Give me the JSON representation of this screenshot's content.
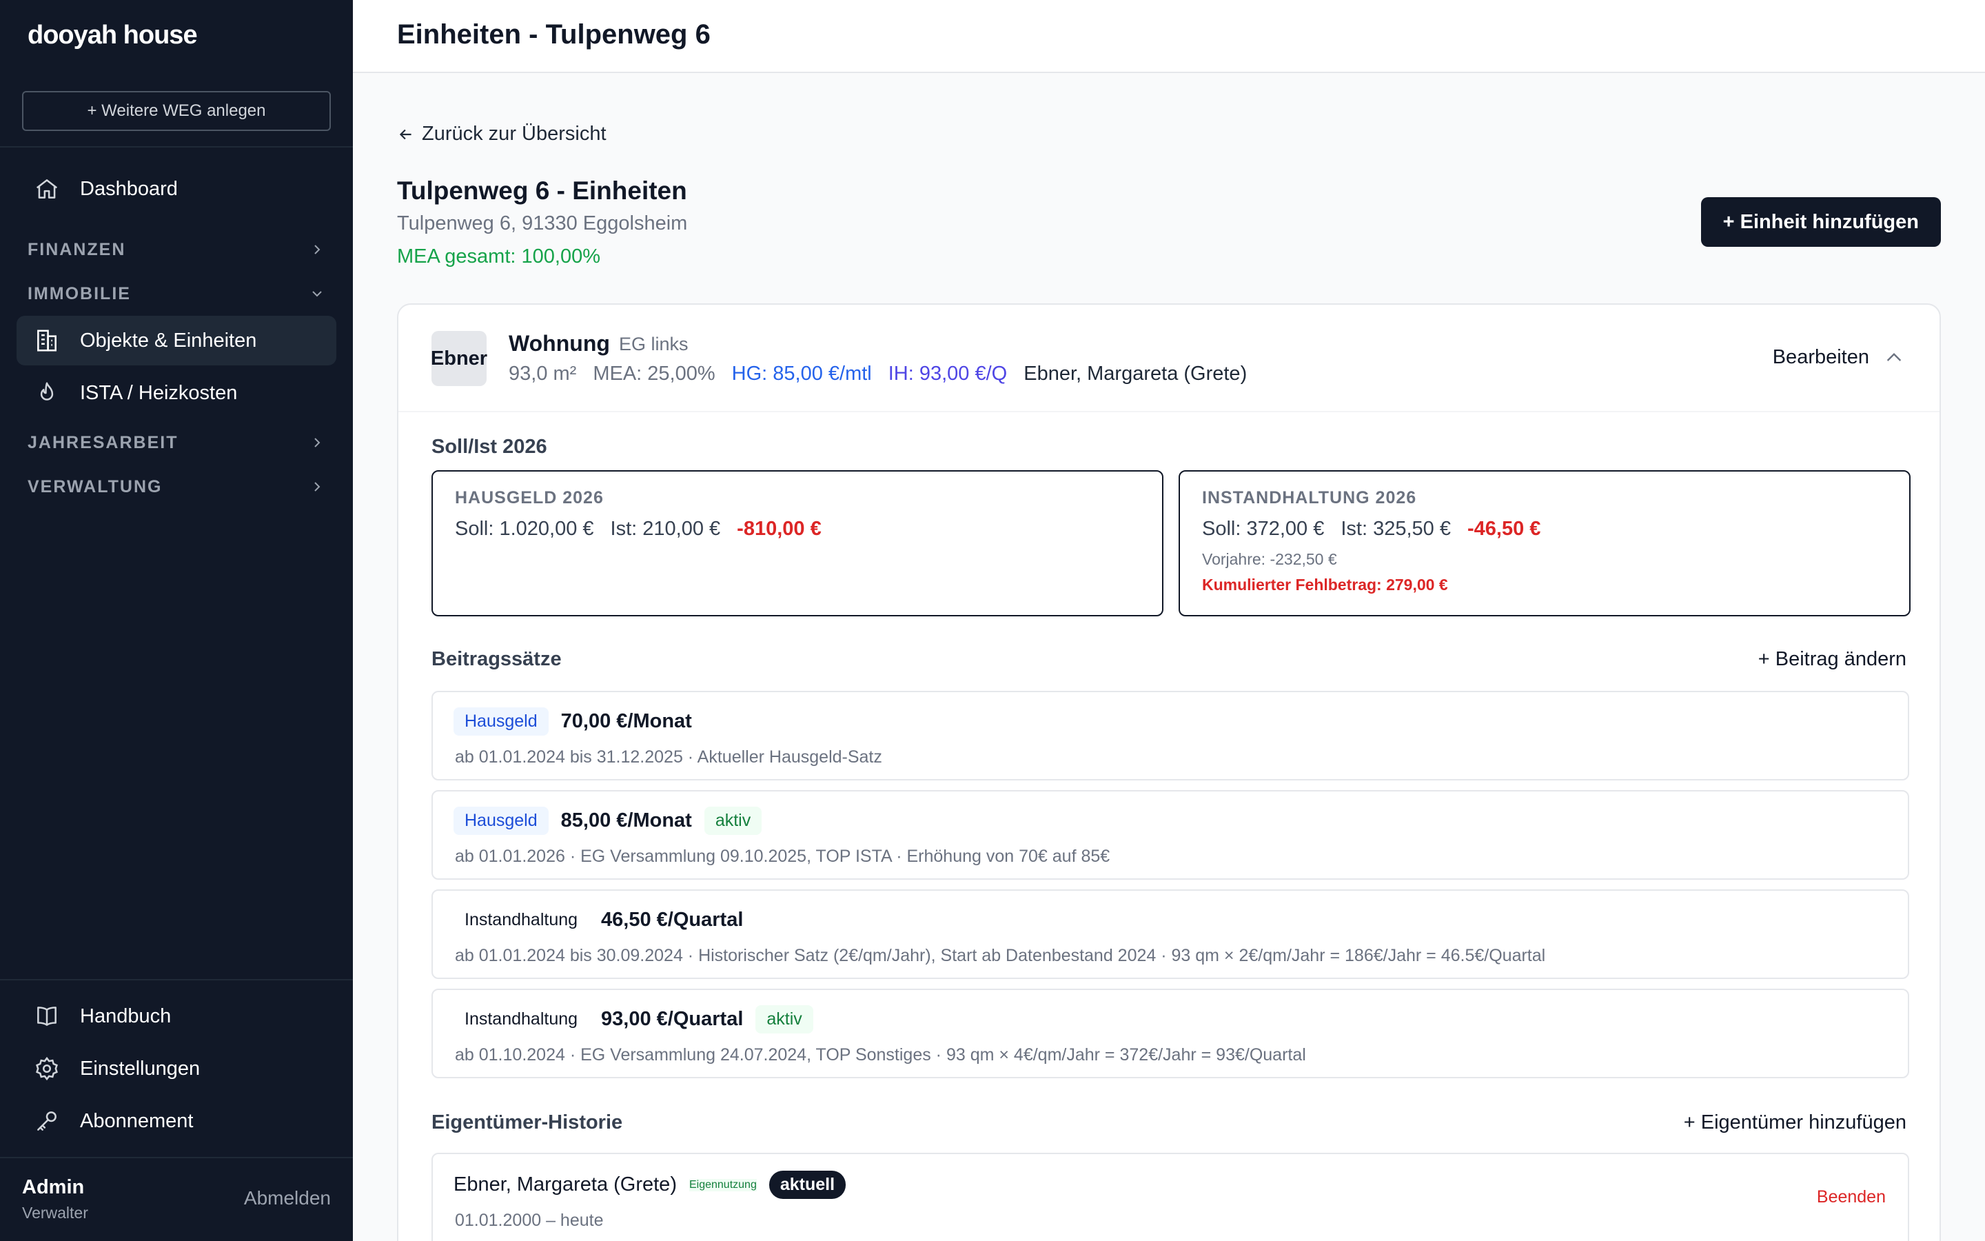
{
  "sidebar": {
    "brand": "dooyah house",
    "new_weg": "+ Weitere WEG anlegen",
    "dashboard": "Dashboard",
    "groups": {
      "finanzen": "FINANZEN",
      "immobilie": "IMMOBILIE",
      "jahresarbeit": "JAHRESARBEIT",
      "verwaltung": "VERWALTUNG"
    },
    "objekte": "Objekte & Einheiten",
    "ista": "ISTA / Heizkosten",
    "handbuch": "Handbuch",
    "einstellungen": "Einstellungen",
    "abonnement": "Abonnement",
    "user": {
      "name": "Admin",
      "role": "Verwalter",
      "logout": "Abmelden"
    }
  },
  "header": {
    "title": "Einheiten - Tulpenweg 6"
  },
  "main": {
    "back": "Zurück zur Übersicht",
    "title": "Tulpenweg 6 - Einheiten",
    "address": "Tulpenweg 6, 91330 Eggolsheim",
    "mea_total": "MEA gesamt: 100,00%",
    "add_unit": "+ Einheit hinzufügen"
  },
  "unit": {
    "avatar": "Ebner",
    "type": "Wohnung",
    "location": "EG links",
    "area": "93,0 m²",
    "mea": "MEA: 25,00%",
    "hg": "HG: 85,00 €/mtl",
    "ih": "IH: 93,00 €/Q",
    "owner": "Ebner, Margareta (Grete)",
    "edit": "Bearbeiten"
  },
  "soll_ist": {
    "heading": "Soll/Ist 2026",
    "hausgeld": {
      "caption": "HAUSGELD 2026",
      "soll": "Soll: 1.020,00 €",
      "ist": "Ist: 210,00 €",
      "diff": "-810,00 €"
    },
    "instandhaltung": {
      "caption": "INSTANDHALTUNG 2026",
      "soll": "Soll: 372,00 €",
      "ist": "Ist: 325,50 €",
      "diff": "-46,50 €",
      "prev": "Vorjahre: -232,50 €",
      "cumulative": "Kumulierter Fehlbetrag: 279,00 €"
    }
  },
  "rates": {
    "heading": "Beitragssätze",
    "action": "+ Beitrag ändern",
    "items": [
      {
        "type": "Hausgeld",
        "amount": "70,00 €/Monat",
        "status": "",
        "detail": "ab 01.01.2024 bis 31.12.2025 · Aktueller Hausgeld-Satz"
      },
      {
        "type": "Hausgeld",
        "amount": "85,00 €/Monat",
        "status": "aktiv",
        "detail": "ab 01.01.2026 · EG Versammlung 09.10.2025, TOP ISTA · Erhöhung von 70€ auf 85€"
      },
      {
        "type": "Instandhaltung",
        "amount": "46,50 €/Quartal",
        "status": "",
        "detail": "ab 01.01.2024 bis 30.09.2024 · Historischer Satz (2€/qm/Jahr), Start ab Datenbestand 2024 · 93 qm × 2€/qm/Jahr = 186€/Jahr = 46.5€/Quartal"
      },
      {
        "type": "Instandhaltung",
        "amount": "93,00 €/Quartal",
        "status": "aktiv",
        "detail": "ab 01.10.2024 · EG Versammlung 24.07.2024, TOP Sonstiges · 93 qm × 4€/qm/Jahr = 372€/Jahr = 93€/Quartal"
      }
    ]
  },
  "owners": {
    "heading": "Eigentümer-Historie",
    "action": "+ Eigentümer hinzufügen",
    "items": [
      {
        "name": "Ebner, Margareta (Grete)",
        "usage": "Eigennutzung",
        "status": "aktuell",
        "period": "01.01.2000 – heute",
        "end": "Beenden"
      }
    ]
  }
}
